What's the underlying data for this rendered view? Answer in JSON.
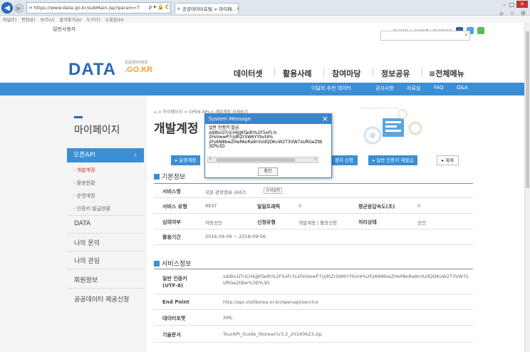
{
  "browser": {
    "url": "https://www.data.go.kr/subMain.jsp?param=T",
    "url_icons": "ρ ▾ 🔒 C",
    "tab_title": "공공데이터포털 > 마이페...",
    "tab_close": "×",
    "menu": [
      "파일(F)",
      "편집(E)",
      "보기(V)",
      "즐겨찾기(A)",
      "도구(T)",
      "도움말(H)"
    ],
    "right_icons": "⌂ ☆ ⚙"
  },
  "site": {
    "gov_label": "일반사용자",
    "util_links": "로그아웃 | 사이트맵 | 마이페이지",
    "logo_text": "DATA",
    "logo_sub": "공공데이터포털",
    "logo_domain": ".GO.KR",
    "gnb": [
      "데이터셋",
      "활용사례",
      "참여마당",
      "정보공유",
      "≡전체메뉴"
    ],
    "sub_menu": [
      "이달의 추천 데이터",
      "공지사항",
      "자료실",
      "FAQ",
      "Q&A"
    ],
    "colors": {
      "primary": "#3a8ed6",
      "logo": "#2968b8",
      "accent": "#f0a030"
    }
  },
  "sidebar": {
    "title": "마이페이지",
    "active": "오픈API",
    "active_chevron": "›",
    "subs": [
      "- 개발계정",
      "- 활용현황",
      "- 운영계정",
      "- 인증키 발급현황"
    ],
    "items": [
      "DATA",
      "나의 문의",
      "나의 관심",
      "회원정보",
      "공공데이터 제공신청"
    ]
  },
  "main": {
    "breadcrumb": "⌂ > 마이페이지 > OPEN API > 개발계정 상세보기",
    "title": "개발계정",
    "buttons": [
      "▸ 운영계정",
      "정지 신청",
      "▸ 일반 인증키 재발급",
      "▸ 목록"
    ],
    "basic_title": "기본정보",
    "basic": {
      "service_name_label": "서비스명",
      "service_name": "국문 관광정보 서비스",
      "detail_chip": "상세설명",
      "service_type_label": "서비스 유형",
      "service_type": "REST",
      "traffic_label": "일일트래픽",
      "traffic": "0",
      "avg_speed_label": "평균응답속도(초)",
      "avg_speed": "0",
      "approval_label": "심의여부",
      "approval": "자동승인",
      "req_type_label": "신청유형",
      "req_type": "개발계정 | 활용신청",
      "status_label": "처리상태",
      "status": "승인",
      "period_label": "활용기간",
      "period": "2016-09-06 ~ 2018-09-06"
    },
    "service_title": "서비스정보",
    "service": {
      "key_label": "일반 인증키\n(UTF-8)",
      "key_value": "sddbcGTnCHkJJKTadh%2F5oFL%2FeVwwP7rjdhZrSW6YYbvt4%2Fy6N8bwZHePAoRa9rrIUdQDKvW2T3VW7sURGeZtBw%3D%3D",
      "endpoint_label": "End Point",
      "endpoint": "http://api.visitkorea.or.kr/openapi/service",
      "format_label": "데이터포맷",
      "format": "XML",
      "doc_label": "기술문서",
      "doc": "TourAPI_Guide_(Korean)v3.2_20160623.zip"
    }
  },
  "dialog": {
    "title": "System Message",
    "close": "×",
    "body": "일반 인증키 발급\nsddbcGTnCHkJJKTadh%2F5oFL%\n2FeVwwP7rjdhZrSW6YYbvt4%\n2Fy6N8bwZHePAoRa9rrIUdQDKvW2T3VW7sURGeZtB\n3D%3D",
    "scroll_left": "‹",
    "scroll_right": "›",
    "ok": "확인"
  }
}
